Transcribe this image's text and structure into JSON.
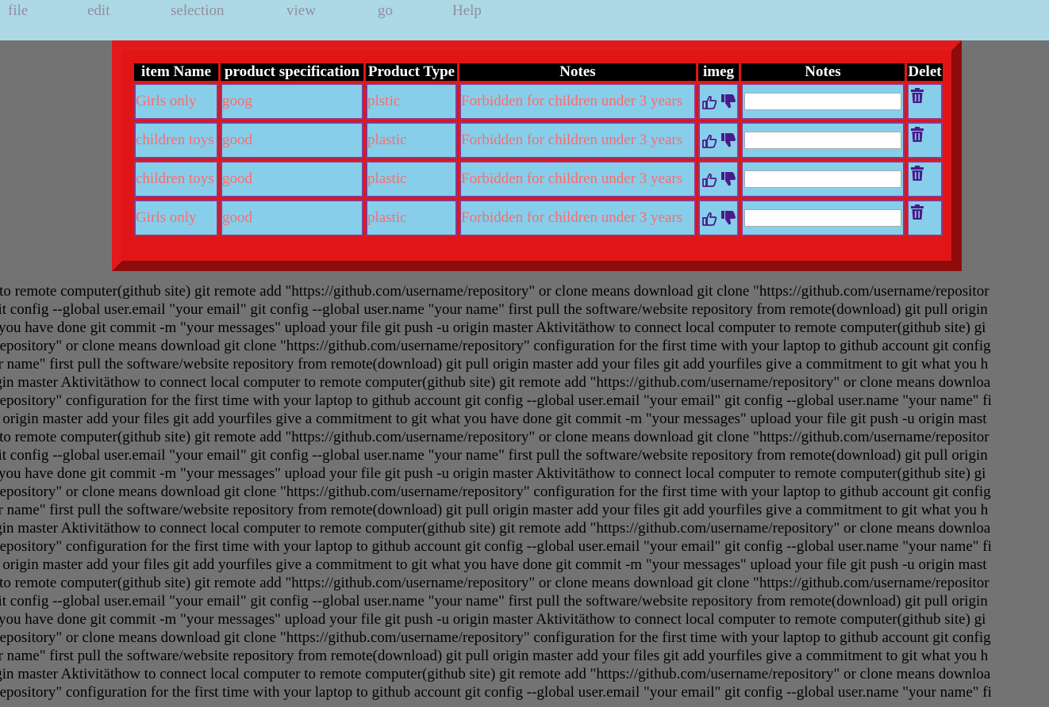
{
  "menu": [
    "file",
    "edit",
    "selection",
    "view",
    "go",
    "Help"
  ],
  "table": {
    "headers": [
      "item Name",
      "product specification",
      "Product Type",
      "Notes",
      "imeg",
      "Notes",
      "Delet"
    ],
    "rows": [
      {
        "name": "Girls only",
        "spec": "goog",
        "type": "plstic",
        "notes": "Forbidden for children under 3 years"
      },
      {
        "name": "children toys",
        "spec": "good",
        "type": "plastic",
        "notes": "Forbidden for children under 3 years"
      },
      {
        "name": "children toys",
        "spec": "good",
        "type": "plastic",
        "notes": "Forbidden for children under 3 years"
      },
      {
        "name": "Girls only",
        "spec": "good",
        "type": "plastic",
        "notes": "Forbidden for children under 3 years"
      }
    ]
  },
  "icons": {
    "like": "thumbs-up-icon",
    "dislike": "thumbs-down-icon",
    "delete": "trash-icon"
  },
  "colors": {
    "menubar": "#add8e6",
    "background": "#737373",
    "frame": "#e01515",
    "cell": "#87ceeb",
    "cell_text": "#ff6a6a",
    "icon": "#4b1a8a"
  },
  "body_lines": [
    "r to remote computer(github site) git remote add \"https://github.com/username/repository\" or clone means download git clone \"https://github.com/username/repositor",
    " git config --global user.email \"your email\" git config --global user.name \"your name\" first pull the software/website repository from remote(download) git pull origin",
    "t you have done git commit -m \"your messages\" upload your file git push -u origin master Aktivitäthow to connect local computer to remote computer(github site) gi",
    "/repository\" or clone means download git clone \"https://github.com/username/repository\" configuration for the first time with your laptop to github account git config",
    "ur name\" first pull the software/website repository from remote(download) git pull origin master add your files git add yourfiles give a commitment to git what you h",
    "igin master Aktivitäthow to connect local computer to remote computer(github site) git remote add \"https://github.com/username/repository\" or clone means downloa",
    "/repository\" configuration for the first time with your laptop to github account git config --global user.email \"your email\" git config --global user.name \"your name\" fi",
    "ll origin master add your files git add yourfiles give a commitment to git what you have done git commit -m \"your messages\" upload your file git push -u origin mast",
    "r to remote computer(github site) git remote add \"https://github.com/username/repository\" or clone means download git clone \"https://github.com/username/repositor",
    " git config --global user.email \"your email\" git config --global user.name \"your name\" first pull the software/website repository from remote(download) git pull origin",
    "t you have done git commit -m \"your messages\" upload your file git push -u origin master Aktivitäthow to connect local computer to remote computer(github site) gi",
    "/repository\" or clone means download git clone \"https://github.com/username/repository\" configuration for the first time with your laptop to github account git config",
    "ur name\" first pull the software/website repository from remote(download) git pull origin master add your files git add yourfiles give a commitment to git what you h",
    "igin master Aktivitäthow to connect local computer to remote computer(github site) git remote add \"https://github.com/username/repository\" or clone means downloa",
    "/repository\" configuration for the first time with your laptop to github account git config --global user.email \"your email\" git config --global user.name \"your name\" fi",
    "ll origin master add your files git add yourfiles give a commitment to git what you have done git commit -m \"your messages\" upload your file git push -u origin mast",
    "r to remote computer(github site) git remote add \"https://github.com/username/repository\" or clone means download git clone \"https://github.com/username/repositor",
    " git config --global user.email \"your email\" git config --global user.name \"your name\" first pull the software/website repository from remote(download) git pull origin",
    "t you have done git commit -m \"your messages\" upload your file git push -u origin master Aktivitäthow to connect local computer to remote computer(github site) gi",
    "/repository\" or clone means download git clone \"https://github.com/username/repository\" configuration for the first time with your laptop to github account git config",
    "ur name\" first pull the software/website repository from remote(download) git pull origin master add your files git add yourfiles give a commitment to git what you h",
    "igin master Aktivitäthow to connect local computer to remote computer(github site) git remote add \"https://github.com/username/repository\" or clone means downloa",
    "/repository\" configuration for the first time with your laptop to github account git config --global user.email \"your email\" git config --global user.name \"your name\" fi"
  ]
}
